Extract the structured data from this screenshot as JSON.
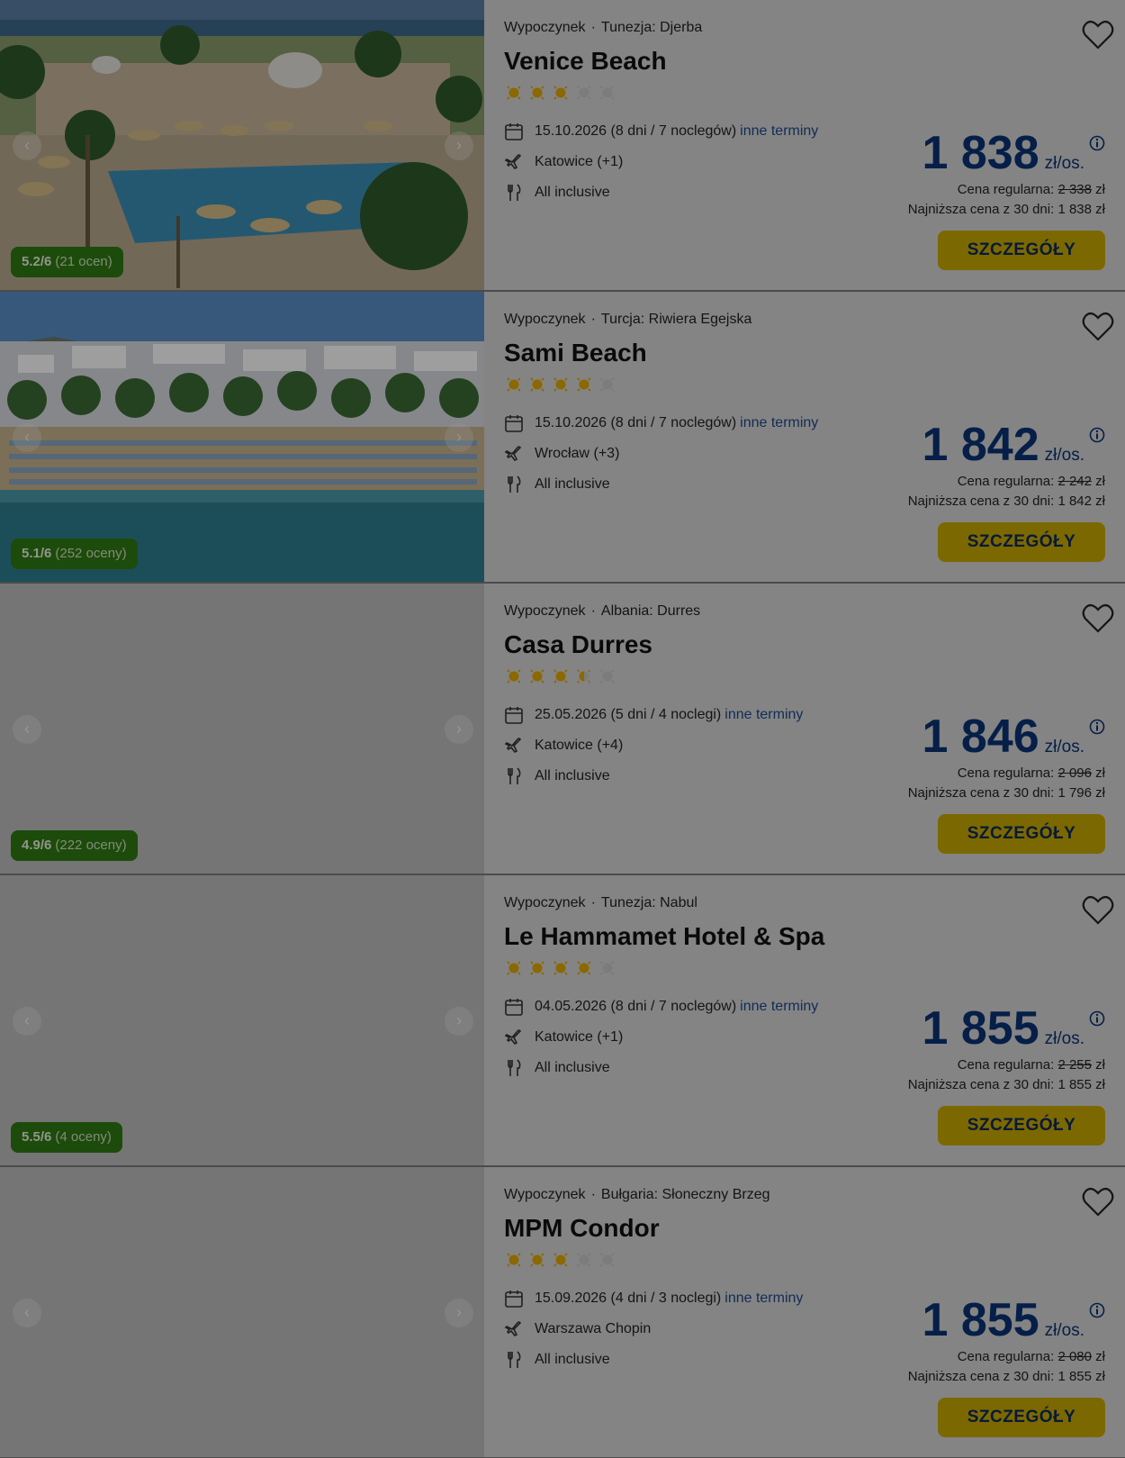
{
  "offers": [
    {
      "category": "Wypoczynek",
      "location": "Tunezja: Djerba",
      "name": "Venice Beach",
      "stars": 3,
      "date": "15.10.2026 (8 dni / 7 noclegów)",
      "other_dates": "inne terminy",
      "departure": "Katowice (+1)",
      "board": "All inclusive",
      "price": "1 838",
      "unit": "zł/os.",
      "regular_label": "Cena regularna:",
      "regular_price": "2 338",
      "currency": "zł",
      "lowest_label": "Najniższa cena z 30 dni:",
      "lowest_price": "1 838 zł",
      "button": "SZCZEGÓŁY",
      "rating_score": "5.2/6",
      "rating_count": "(21 ocen)",
      "image": "resort-pool"
    },
    {
      "category": "Wypoczynek",
      "location": "Turcja: Riwiera Egejska",
      "name": "Sami Beach",
      "stars": 4,
      "date": "15.10.2026 (8 dni / 7 noclegów)",
      "other_dates": "inne terminy",
      "departure": "Wrocław (+3)",
      "board": "All inclusive",
      "price": "1 842",
      "unit": "zł/os.",
      "regular_label": "Cena regularna:",
      "regular_price": "2 242",
      "currency": "zł",
      "lowest_label": "Najniższa cena z 30 dni:",
      "lowest_price": "1 842 zł",
      "button": "SZCZEGÓŁY",
      "rating_score": "5.1/6",
      "rating_count": "(252 oceny)",
      "image": "beach-town"
    },
    {
      "category": "Wypoczynek",
      "location": "Albania: Durres",
      "name": "Casa Durres",
      "stars": 3.5,
      "date": "25.05.2026 (5 dni / 4 noclegi)",
      "other_dates": "inne terminy",
      "departure": "Katowice (+4)",
      "board": "All inclusive",
      "price": "1 846",
      "unit": "zł/os.",
      "regular_label": "Cena regularna:",
      "regular_price": "2 096",
      "currency": "zł",
      "lowest_label": "Najniższa cena z 30 dni:",
      "lowest_price": "1 796 zł",
      "button": "SZCZEGÓŁY",
      "rating_score": "4.9/6",
      "rating_count": "(222 oceny)",
      "image": "placeholder"
    },
    {
      "category": "Wypoczynek",
      "location": "Tunezja: Nabul",
      "name": "Le Hammamet Hotel & Spa",
      "stars": 4,
      "date": "04.05.2026 (8 dni / 7 noclegów)",
      "other_dates": "inne terminy",
      "departure": "Katowice (+1)",
      "board": "All inclusive",
      "price": "1 855",
      "unit": "zł/os.",
      "regular_label": "Cena regularna:",
      "regular_price": "2 255",
      "currency": "zł",
      "lowest_label": "Najniższa cena z 30 dni:",
      "lowest_price": "1 855 zł",
      "button": "SZCZEGÓŁY",
      "rating_score": "5.5/6",
      "rating_count": "(4 oceny)",
      "image": "placeholder"
    },
    {
      "category": "Wypoczynek",
      "location": "Bułgaria: Słoneczny Brzeg",
      "name": "MPM Condor",
      "stars": 3,
      "date": "15.09.2026 (4 dni / 3 noclegi)",
      "other_dates": "inne terminy",
      "departure": "Warszawa Chopin",
      "board": "All inclusive",
      "price": "1 855",
      "unit": "zł/os.",
      "regular_label": "Cena regularna:",
      "regular_price": "2 080",
      "currency": "zł",
      "lowest_label": "Najniższa cena z 30 dni:",
      "lowest_price": "1 855 zł",
      "button": "SZCZEGÓŁY",
      "rating_score": "",
      "rating_count": "",
      "image": "placeholder"
    }
  ],
  "colors": {
    "price": "#0a3375",
    "button": "#c9a800",
    "rating_badge": "#2f7a12",
    "link": "#1e4a8c",
    "star_on": "#e0a800",
    "star_off": "#c8c8c8"
  },
  "icons": {
    "calendar": "calendar-icon",
    "plane": "plane-icon",
    "board": "fork-knife-icon",
    "favorite": "heart-icon",
    "info": "info-icon"
  }
}
